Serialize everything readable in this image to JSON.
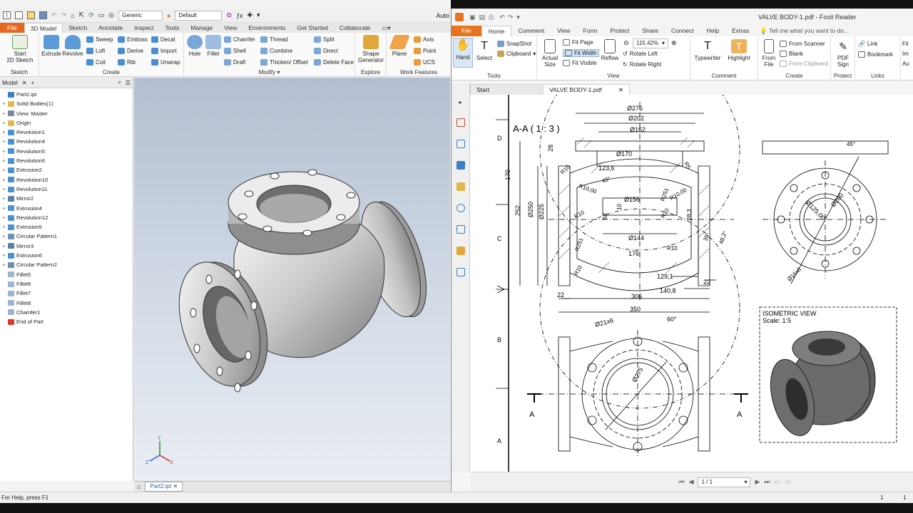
{
  "inventor": {
    "qat": {
      "appearance": "Generic",
      "material": "Default",
      "auto_label": "Auto"
    },
    "tabs": [
      "File",
      "3D Model",
      "Sketch",
      "Annotate",
      "Inspect",
      "Tools",
      "Manage",
      "View",
      "Environments",
      "Get Started",
      "Collaborate"
    ],
    "groups": {
      "sketch": "Sketch",
      "create": "Create",
      "modify": "Modify",
      "explore": "Explore",
      "work_features": "Work Features"
    },
    "ribbon": {
      "start_sketch": "Start",
      "start_sketch2": "2D Sketch",
      "extrude": "Extrude",
      "revolve": "Revolve",
      "sweep": "Sweep",
      "loft": "Loft",
      "coil": "Coil",
      "emboss": "Emboss",
      "derive": "Derive",
      "rib": "Rib",
      "decal": "Decal",
      "import": "Import",
      "unwrap": "Unwrap",
      "hole": "Hole",
      "fillet": "Fillet",
      "chamfer": "Chamfer",
      "shell": "Shell",
      "draft": "Draft",
      "thread": "Thread",
      "combine": "Combine",
      "thicken": "Thicken/ Offset",
      "split": "Split",
      "direct": "Direct",
      "delete_face": "Delete Face",
      "shape_gen": "Shape",
      "shape_gen2": "Generator",
      "plane": "Plane",
      "axis": "Axis",
      "point": "Point",
      "ucs": "UCS"
    },
    "browser": {
      "title": "Model",
      "items": [
        {
          "label": "Part2.ipt",
          "icon": "part-icon",
          "c": "#3b7fc4",
          "p": ""
        },
        {
          "label": "Solid Bodies(1)",
          "icon": "folder-icon",
          "c": "#e2b94a",
          "p": "+"
        },
        {
          "label": "View: Master",
          "icon": "view-icon",
          "c": "#7a8aa6",
          "p": "+"
        },
        {
          "label": "Origin",
          "icon": "folder-icon",
          "c": "#e2b94a",
          "p": "+"
        },
        {
          "label": "Revolution1",
          "icon": "revolve-icon",
          "c": "#4a90d9",
          "p": "+"
        },
        {
          "label": "Revolution4",
          "icon": "revolve-icon",
          "c": "#4a90d9",
          "p": "+"
        },
        {
          "label": "Revolution5",
          "icon": "revolve-icon",
          "c": "#4a90d9",
          "p": "+"
        },
        {
          "label": "Revolution6",
          "icon": "revolve-icon",
          "c": "#4a90d9",
          "p": "+"
        },
        {
          "label": "Extrusion2",
          "icon": "extrude-icon",
          "c": "#4a90d9",
          "p": "+"
        },
        {
          "label": "Revolution10",
          "icon": "revolve-icon",
          "c": "#4a90d9",
          "p": "+"
        },
        {
          "label": "Revolution11",
          "icon": "revolve-icon",
          "c": "#4a90d9",
          "p": "+"
        },
        {
          "label": "Mirror2",
          "icon": "mirror-icon",
          "c": "#5a7fa8",
          "p": "+"
        },
        {
          "label": "Extrusion4",
          "icon": "extrude-icon",
          "c": "#4a90d9",
          "p": "+"
        },
        {
          "label": "Revolution12",
          "icon": "revolve-icon",
          "c": "#4a90d9",
          "p": "+"
        },
        {
          "label": "Extrusion5",
          "icon": "extrude-icon",
          "c": "#4a90d9",
          "p": "+"
        },
        {
          "label": "Circular Pattern1",
          "icon": "pattern-icon",
          "c": "#6f8fb5",
          "p": "+"
        },
        {
          "label": "Mirror3",
          "icon": "mirror-icon",
          "c": "#5a7fa8",
          "p": "+"
        },
        {
          "label": "Extrusion6",
          "icon": "extrude-icon",
          "c": "#4a90d9",
          "p": "+"
        },
        {
          "label": "Circular Pattern2",
          "icon": "pattern-icon",
          "c": "#6f8fb5",
          "p": "+"
        },
        {
          "label": "Fillet5",
          "icon": "fillet-icon",
          "c": "#9cb5d4",
          "p": ""
        },
        {
          "label": "Fillet6",
          "icon": "fillet-icon",
          "c": "#9cb5d4",
          "p": ""
        },
        {
          "label": "Fillet7",
          "icon": "fillet-icon",
          "c": "#9cb5d4",
          "p": ""
        },
        {
          "label": "Fillet8",
          "icon": "fillet-icon",
          "c": "#9cb5d4",
          "p": ""
        },
        {
          "label": "Chamfer1",
          "icon": "chamfer-icon",
          "c": "#9cb5d4",
          "p": ""
        },
        {
          "label": "End of Part",
          "icon": "end-icon",
          "c": "#d9362b",
          "p": ""
        }
      ]
    },
    "doc_tab": "Part2.ipt",
    "status": "For Help, press F1",
    "axis_labels": {
      "x": "X",
      "y": "Y",
      "z": "Z"
    }
  },
  "foxit": {
    "title": "VALVE BODY-1.pdf - Foxit Reader",
    "tabs": [
      "File",
      "Home",
      "Comment",
      "View",
      "Form",
      "Protect",
      "Share",
      "Connect",
      "Help",
      "Extras"
    ],
    "tell_me": "Tell me what you want to do...",
    "ribbon": {
      "hand": "Hand",
      "select": "Select",
      "snapshot": "SnapShot",
      "clipboard": "Clipboard",
      "actual_size": "Actual",
      "actual_size2": "Size",
      "fit_page": "Fit Page",
      "fit_width": "Fit Width",
      "fit_visible": "Fit Visible",
      "reflow": "Reflow",
      "zoom": "115.42%",
      "rotate_left": "Rotate Left",
      "rotate_right": "Rotate Right",
      "typewriter": "Typewriter",
      "highlight": "Highlight",
      "from_file": "From",
      "from_file2": "File",
      "from_scanner": "From Scanner",
      "blank": "Blank",
      "from_clipboard": "From Clipboard",
      "pdf_sign": "PDF",
      "pdf_sign2": "Sign",
      "link": "Link",
      "bookmark": "Bookmark",
      "fi": "Fil",
      "im": "Im",
      "au": "Au"
    },
    "groups": {
      "tools": "Tools",
      "view": "View",
      "comment": "Comment",
      "create": "Create",
      "protect": "Protect",
      "links": "Links"
    },
    "doc_tabs": [
      "Start",
      "VALVE BODY-1.pdf"
    ],
    "page_nav": "1 / 1",
    "status_right": "1"
  },
  "drawing": {
    "section_title": "A-A ( 1 : 3 )",
    "row_labels": [
      "D",
      "C",
      "B",
      "A"
    ],
    "section_marker": "A",
    "dims": {
      "d276": "Ø276",
      "d202": "Ø202",
      "d162": "Ø162",
      "d170": "Ø170",
      "d156": "Ø156",
      "d144": "Ø144",
      "d250": "Ø250",
      "d225": "Ø225",
      "d200": "Ø200",
      "d125": "Ø125,00",
      "d16": "Ø16x8",
      "d21": "Ø21x6",
      "d275": "Ø275",
      "v123": "123,6",
      "v176": "176",
      "v129": "129,1",
      "v306": "306",
      "v140": "140,8",
      "v350": "350",
      "v22a": "22",
      "v22b": "22",
      "v28": "28",
      "v170": "170",
      "v252": "252",
      "v50": "50",
      "v10": "10",
      "v28_3": "28,3",
      "r5": "R5",
      "r10a": "R10",
      "r10b": "R10",
      "r10c": "R10",
      "r10d": "R10",
      "r10e": "R10",
      "r10_00a": "R10,00",
      "r10_00b": "R10,00",
      "r251a": "R251",
      "r251b": "R251",
      "a43": "43°",
      "a39": "39°",
      "a48": "48,2°",
      "a45": "45°",
      "a60": "60°"
    },
    "iso_title": "ISOMETRIC VIEW",
    "iso_scale": "Scale: 1:5"
  }
}
